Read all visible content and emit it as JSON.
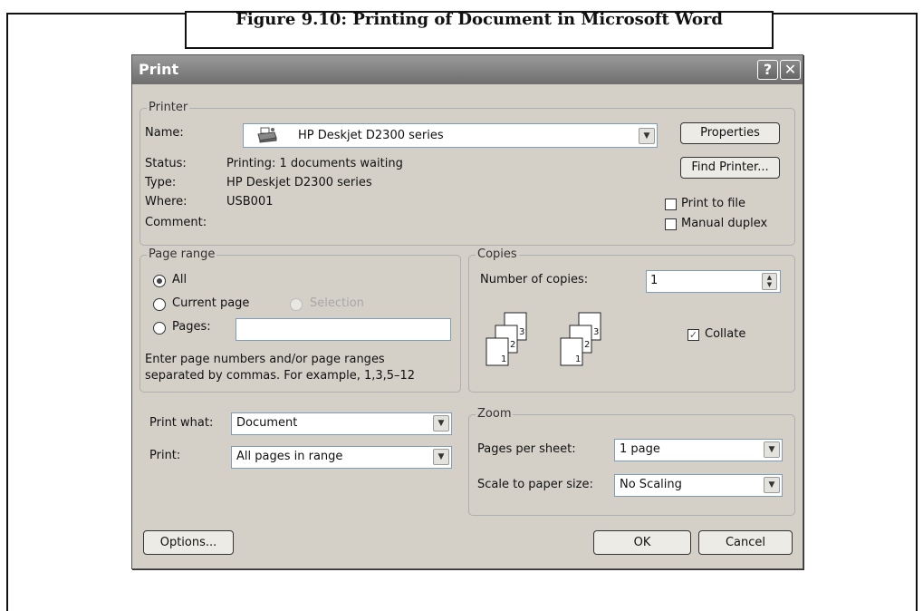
{
  "caption": "Figure 9.10: Printing of Document in Microsoft Word",
  "dialog": {
    "title": "Print",
    "help_glyph": "?",
    "close_glyph": "✕"
  },
  "printer": {
    "legend": "Printer",
    "name_label": "Name:",
    "name_value": "HP Deskjet D2300 series",
    "status_label": "Status:",
    "status_value": "Printing: 1 documents waiting",
    "type_label": "Type:",
    "type_value": "HP Deskjet D2300 series",
    "where_label": "Where:",
    "where_value": "USB001",
    "comment_label": "Comment:",
    "properties_button": "Properties",
    "find_printer_button": "Find Printer...",
    "print_to_file": "Print to file",
    "manual_duplex": "Manual duplex"
  },
  "page_range": {
    "legend": "Page range",
    "all": "All",
    "current_page": "Current page",
    "selection": "Selection",
    "pages": "Pages:",
    "pages_value": "",
    "hint_line1": "Enter page numbers and/or page ranges",
    "hint_line2": "separated by commas.  For example, 1,3,5–12"
  },
  "copies": {
    "legend": "Copies",
    "number_label": "Number of copies:",
    "number_value": "1",
    "collate": "Collate",
    "collate_checked": true,
    "page_labels": [
      "3",
      "2",
      "1"
    ]
  },
  "print_what": {
    "label": "Print what:",
    "value": "Document"
  },
  "print": {
    "label": "Print:",
    "value": "All pages in range"
  },
  "zoom": {
    "legend": "Zoom",
    "pages_per_sheet_label": "Pages per sheet:",
    "pages_per_sheet_value": "1 page",
    "scale_label": "Scale to paper size:",
    "scale_value": "No Scaling"
  },
  "footer": {
    "options_button": "Options...",
    "ok_button": "OK",
    "cancel_button": "Cancel"
  }
}
